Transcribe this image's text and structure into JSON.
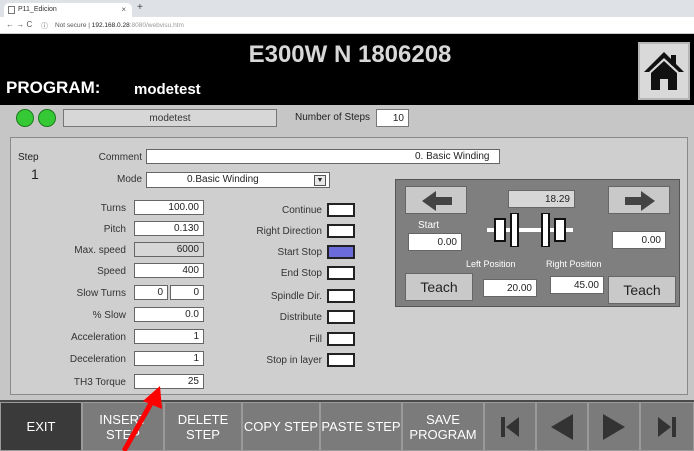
{
  "browser": {
    "tab_title": "P11_Edicion",
    "new_tab": "+",
    "nav_glyphs": "← → C",
    "security": "Not secure",
    "url_host": "192.168.0.28",
    "url_rest": ":8080/webvisu.htm"
  },
  "header": {
    "machine": "E300W N 1806208",
    "program_label": "PROGRAM:",
    "program_name": "modetest"
  },
  "status": {
    "program_field": "modetest",
    "steps_label": "Number of Steps",
    "steps_value": "10"
  },
  "step": {
    "label": "Step",
    "number": "1",
    "comment_label": "Comment",
    "comment_value": "0.   Basic Winding",
    "mode_label": "Mode",
    "mode_value": "0.Basic Winding"
  },
  "params": [
    {
      "label": "Turns",
      "value": "100.00"
    },
    {
      "label": "Pitch",
      "value": "0.130"
    },
    {
      "label": "Max. speed",
      "value": "6000"
    },
    {
      "label": "Speed",
      "value": "400"
    },
    {
      "label": "Slow Turns",
      "value_a": "0",
      "value_b": "0"
    },
    {
      "label": "% Slow",
      "value": "0.0"
    },
    {
      "label": "Acceleration",
      "value": "1"
    },
    {
      "label": "Deceleration",
      "value": "1"
    },
    {
      "label": "TH3 Torque",
      "value": "25"
    }
  ],
  "options": [
    {
      "label": "Continue",
      "checked": false
    },
    {
      "label": "Right Direction",
      "checked": false
    },
    {
      "label": "Start Stop",
      "checked": true
    },
    {
      "label": "End Stop",
      "checked": false
    },
    {
      "label": "Spindle Dir.",
      "checked": false
    },
    {
      "label": "Distribute",
      "checked": false
    },
    {
      "label": "Fill",
      "checked": false
    },
    {
      "label": "Stop in layer",
      "checked": false
    }
  ],
  "position": {
    "current": "18.29",
    "start_label": "Start",
    "start_value": "0.00",
    "end_value": "0.00",
    "left_label": "Left Position",
    "right_label": "Right Position",
    "left_value": "20.00",
    "right_value": "45.00",
    "teach_left": "Teach",
    "teach_right": "Teach"
  },
  "toolbar": {
    "exit": "EXIT",
    "insert": "INSERT STEP",
    "delete": "DELETE STEP",
    "copy": "COPY STEP",
    "paste": "PASTE STEP",
    "save": "SAVE PROGRAM"
  },
  "colors": {
    "led": "#36c936",
    "checked": "#6b6bdc",
    "header": "#000000",
    "annotation_arrow": "#ff0000"
  }
}
